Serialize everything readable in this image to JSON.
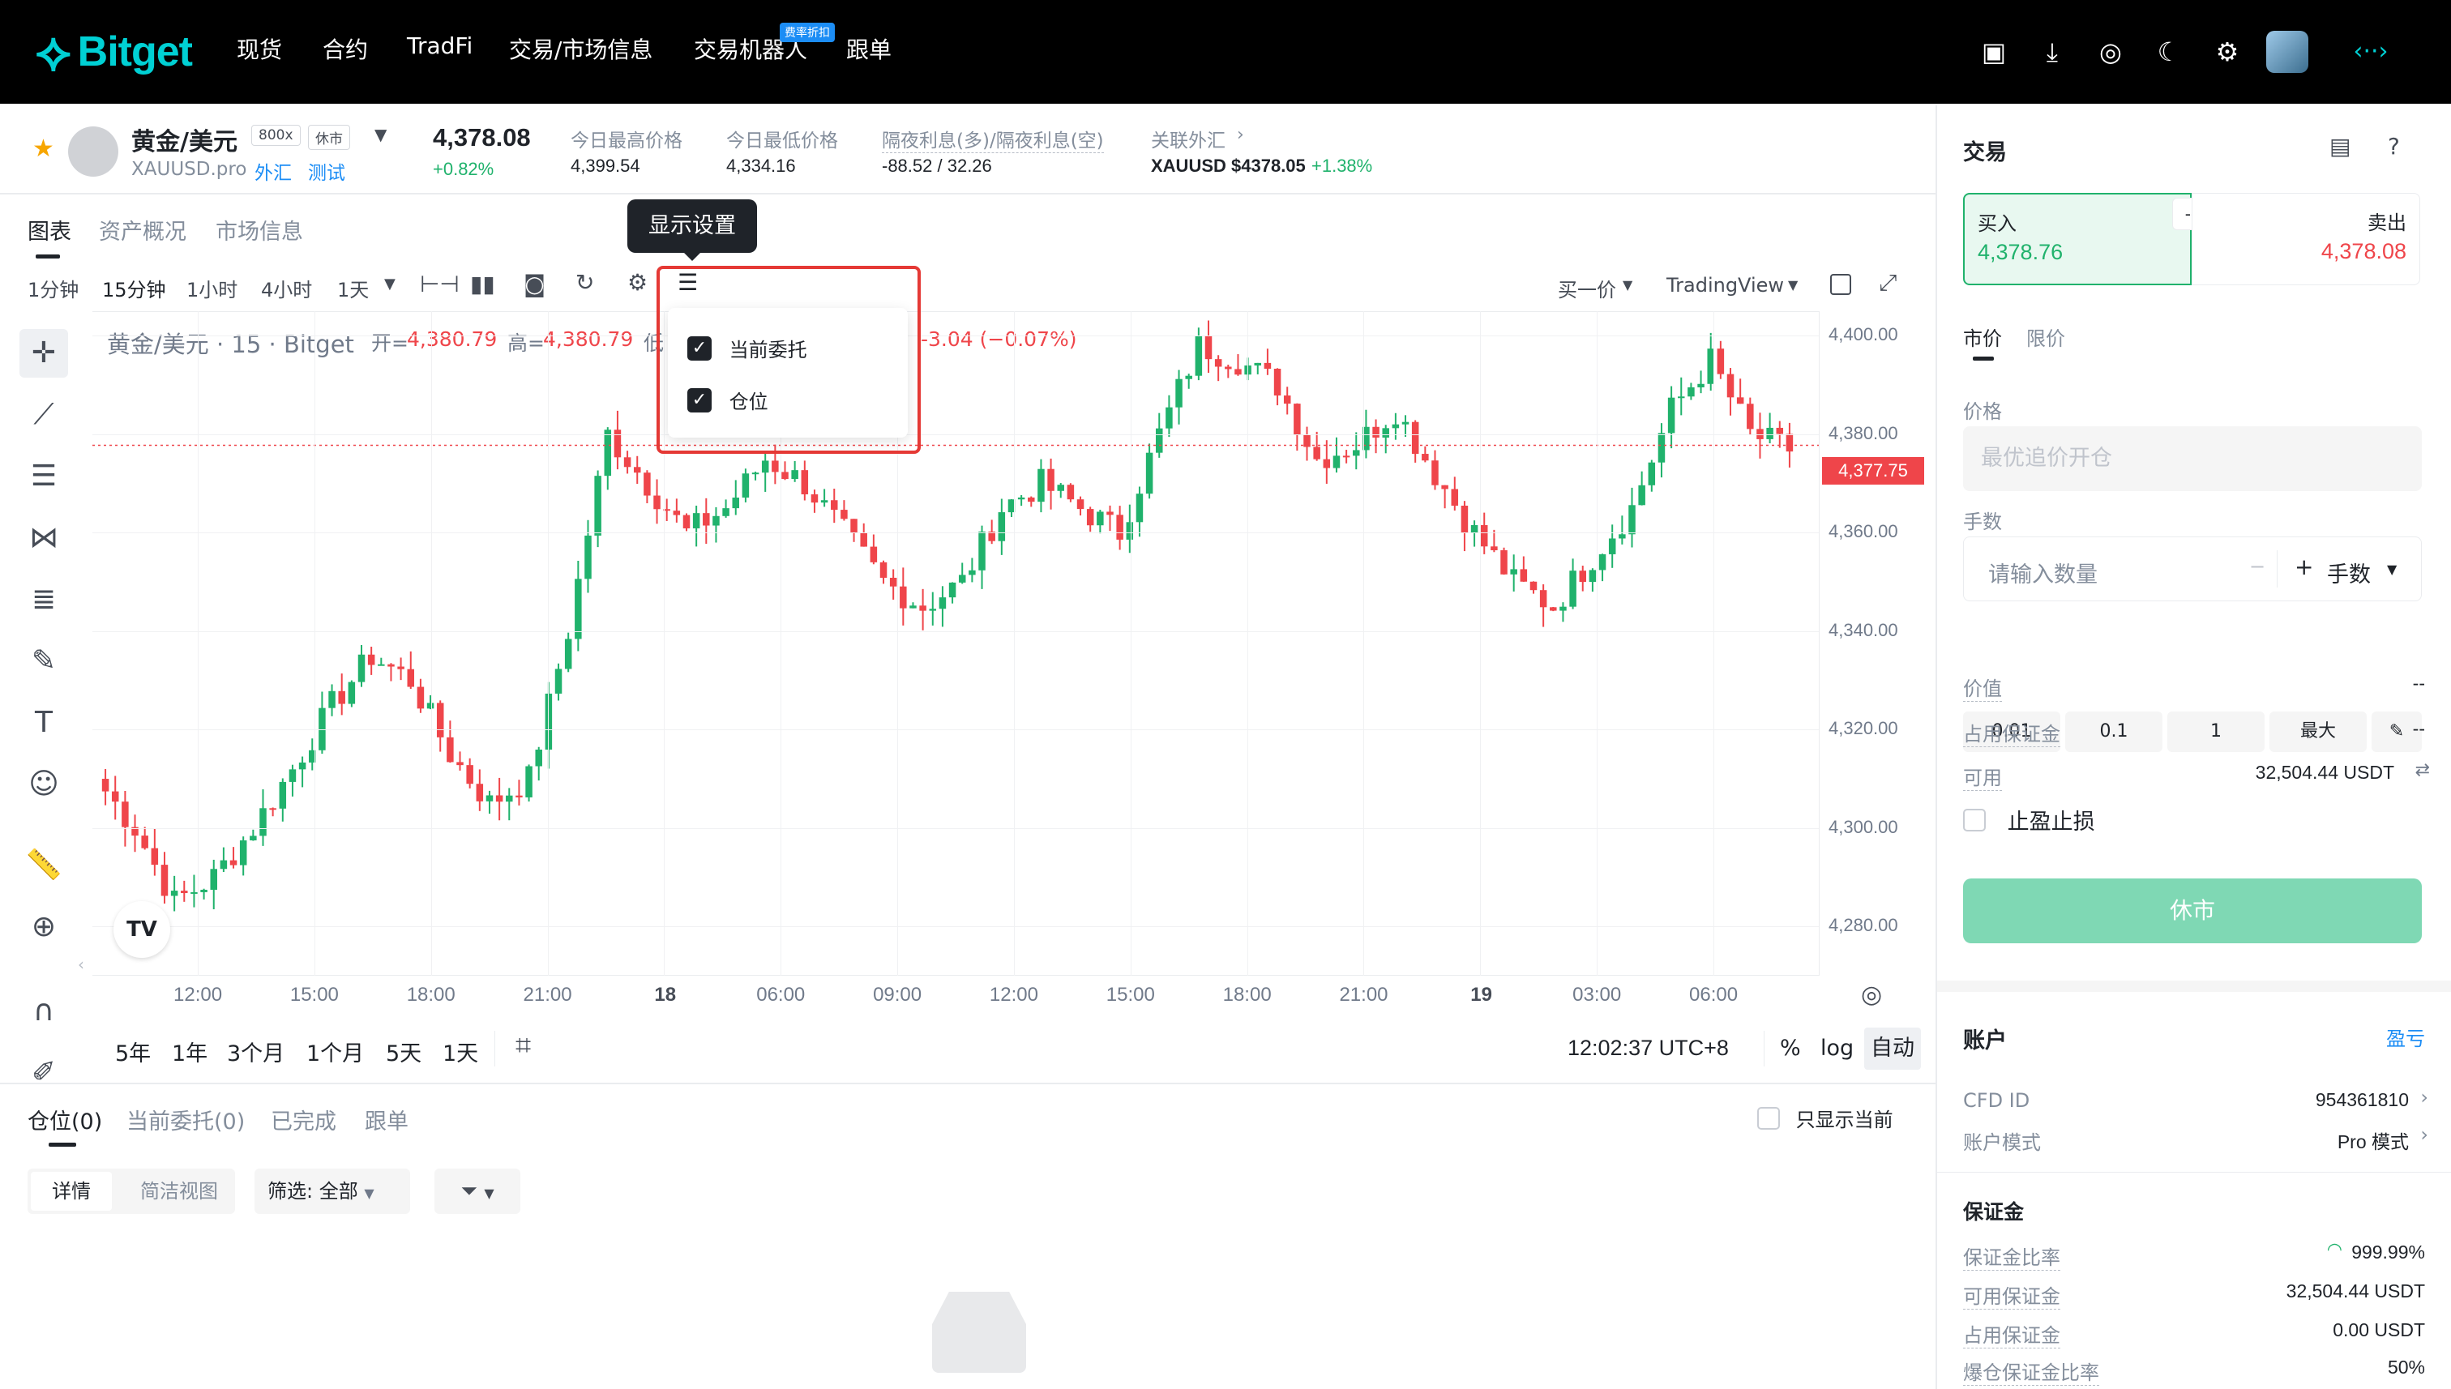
{
  "nav": {
    "logo": "Bitget",
    "items": [
      "现货",
      "合约",
      "TradFi",
      "交易/市场信息",
      "交易机器人",
      "跟单"
    ],
    "badge": "费率折扣"
  },
  "symbol": {
    "name": "黄金/美元",
    "leverage": "800x",
    "status": "休市",
    "code": "XAUUSD.pro",
    "category": "外汇",
    "test": "测试",
    "price": "4,378.08",
    "change": "+0.82%",
    "high_label": "今日最高价格",
    "high": "4,399.54",
    "low_label": "今日最低价格",
    "low": "4,334.16",
    "swap_label": "隔夜利息(多)/隔夜利息(空)",
    "swap": "-88.52 / 32.26",
    "related_label": "关联外汇",
    "related": "XAUUSD $4378.05",
    "related_change": "+1.38%"
  },
  "chart_tabs": [
    "图表",
    "资产概况",
    "市场信息"
  ],
  "toolbar": {
    "intervals": [
      "1分钟",
      "15分钟",
      "1小时",
      "4小时",
      "1天"
    ],
    "active_interval": "15分钟",
    "price_type": "买一价",
    "view": "TradingView",
    "tooltip": "显示设置"
  },
  "display_menu": {
    "items": [
      "当前委托",
      "仓位"
    ]
  },
  "legend": {
    "title": "黄金/美元 · 15 · Bitget",
    "open_label": "开=",
    "open": "4,380.79",
    "high_label": "高=",
    "high": "4,380.79",
    "low_label": "低",
    "change": "-3.04 (−0.07%)"
  },
  "chart_data": {
    "type": "candlestick",
    "x": [
      "12:00",
      "15:00",
      "18:00",
      "21:00",
      "18",
      "06:00",
      "09:00",
      "12:00",
      "15:00",
      "18:00",
      "21:00",
      "19",
      "03:00",
      "06:00"
    ],
    "y_ticks": [
      "4,400.00",
      "4,380.00",
      "4,360.00",
      "4,340.00",
      "4,320.00",
      "4,300.00",
      "4,280.00"
    ],
    "ylim": [
      4270,
      4405
    ],
    "last_price": "4,377.75",
    "series": [
      {
        "close": [
          4310,
          4300,
          4285,
          4290,
          4300,
          4312,
          4325,
          4335,
          4330,
          4315,
          4305,
          4310,
          4340,
          4380,
          4370,
          4360,
          4365,
          4375,
          4370,
          4360,
          4350,
          4345,
          4350,
          4365,
          4370,
          4365,
          4360,
          4380,
          4398,
          4395,
          4390,
          4375,
          4378,
          4385,
          4372,
          4360,
          4350,
          4345,
          4355,
          4365,
          4385,
          4395,
          4380,
          4377
        ]
      }
    ]
  },
  "range_buttons": [
    "5年",
    "1年",
    "3个月",
    "1个月",
    "5天",
    "1天"
  ],
  "clock": "12:02:37 UTC+8",
  "scale_buttons": [
    "%",
    "log",
    "自动"
  ],
  "bottom_tabs": [
    "仓位(0)",
    "当前委托(0)",
    "已完成",
    "跟单"
  ],
  "only_current": "只显示当前",
  "view_toggle": [
    "详情",
    "简洁视图"
  ],
  "filter": "筛选: 全部",
  "trade": {
    "title": "交易",
    "buy_label": "买入",
    "buy_price": "4,378.76",
    "spread": "--",
    "sell_label": "卖出",
    "sell_price": "4,378.08",
    "order_tabs": [
      "市价",
      "限价"
    ],
    "price_label": "价格",
    "price_placeholder": "最优追价开仓",
    "qty_label": "手数",
    "qty_placeholder": "请输入数量",
    "qty_unit": "手数",
    "quick": [
      "0.01",
      "0.1",
      "1",
      "最大"
    ],
    "value_label": "价值",
    "value": "--",
    "margin_label": "占用保证金",
    "margin": "--",
    "available_label": "可用",
    "available": "32,504.44 USDT",
    "tpsl_label": "止盈止损",
    "submit": "休市"
  },
  "account": {
    "title": "账户",
    "pnl_link": "盈亏",
    "cfd_label": "CFD ID",
    "cfd_id": "954361810",
    "mode_label": "账户模式",
    "mode": "Pro 模式",
    "margin_title": "保证金",
    "ratio_label": "保证金比率",
    "ratio": "999.99%",
    "avail_label": "可用保证金",
    "avail": "32,504.44 USDT",
    "used_label": "占用保证金",
    "used": "0.00 USDT",
    "liq_label": "爆仓保证金比率",
    "liq": "50%"
  },
  "colors": {
    "up": "#20b26c",
    "down": "#ef454a",
    "brand": "#00d0d4",
    "buy_bg": "#e8f8f0",
    "submit_bg": "#7fd8b4"
  }
}
